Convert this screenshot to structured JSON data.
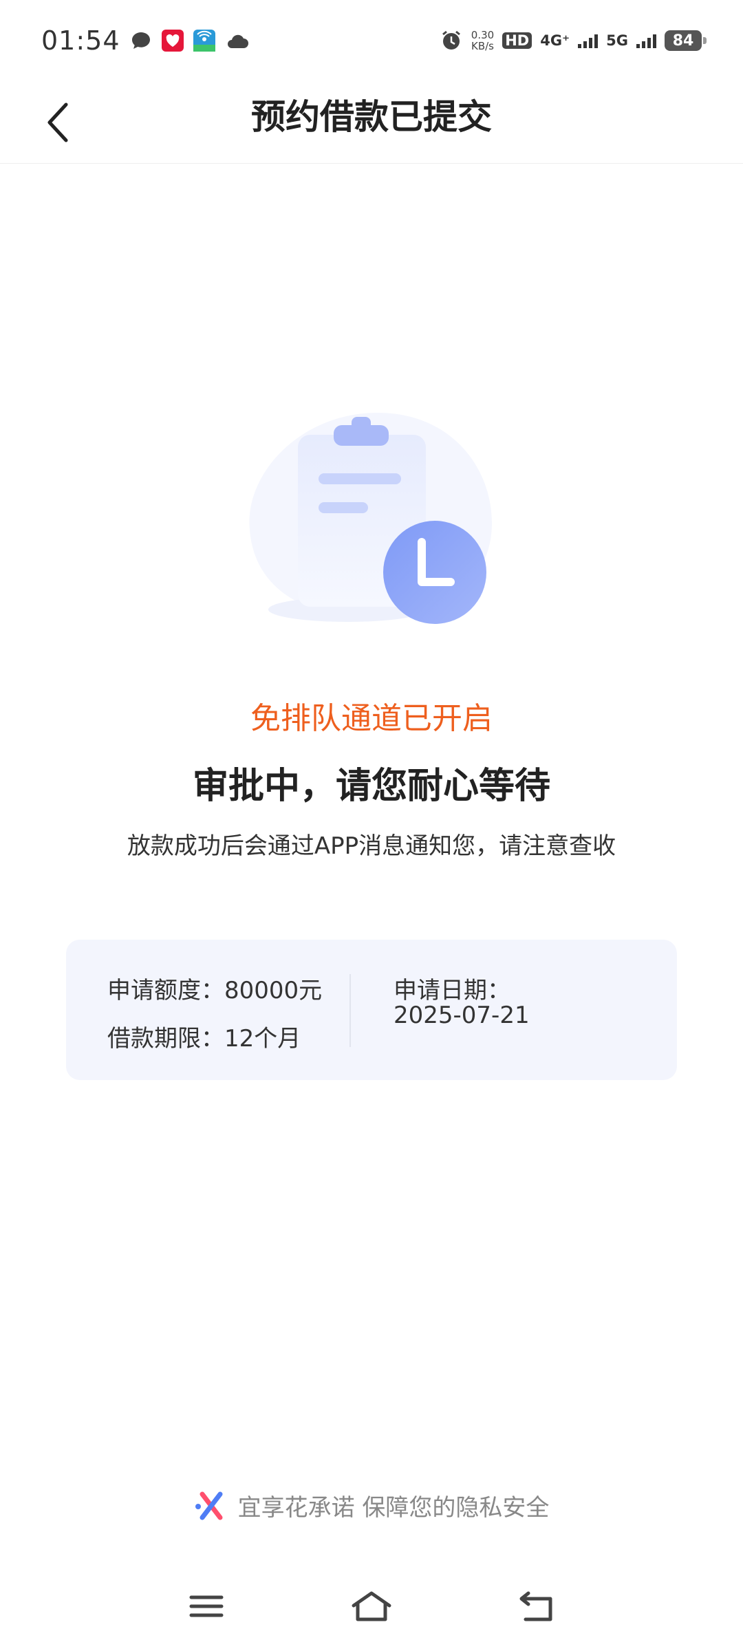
{
  "status_bar": {
    "time": "01:54",
    "net_speed_value": "0.30",
    "net_speed_unit": "KB/s",
    "hd_label": "HD",
    "network_4g": "4G⁺",
    "network_5g": "5G",
    "battery": "84",
    "icons": [
      "chat-bubble-icon",
      "red-app-icon",
      "wifi-app-icon",
      "cloud-icon",
      "alarm-icon"
    ]
  },
  "header": {
    "title": "预约借款已提交"
  },
  "status": {
    "highlight": "免排队通道已开启",
    "heading": "审批中，请您耐心等待",
    "description": "放款成功后会通过APP消息通知您，请注意查收"
  },
  "info": {
    "amount_label": "申请额度：",
    "amount_value": "80000元",
    "term_label": "借款期限：",
    "term_value": "12个月",
    "date_label": "申请日期：",
    "date_value": "2025-07-21"
  },
  "footer": {
    "text": "宜享花承诺 保障您的隐私安全"
  },
  "colors": {
    "accent_orange": "#ee5f1e",
    "card_bg": "#f3f5fd",
    "illustration_blue": "#8fa6f7"
  }
}
